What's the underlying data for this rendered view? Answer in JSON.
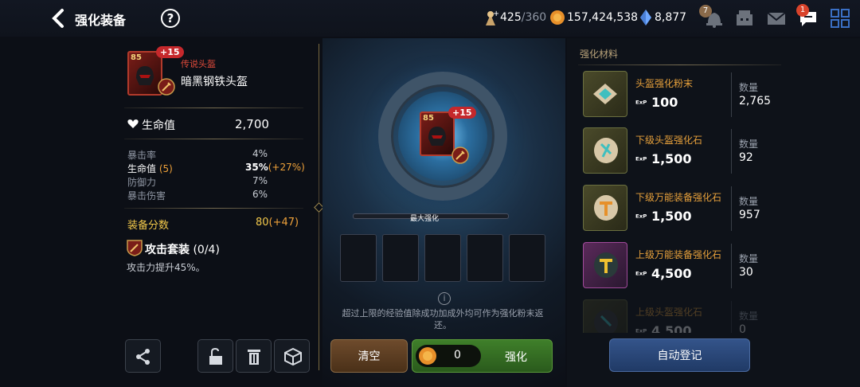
{
  "header": {
    "title": "强化装备",
    "help": "?",
    "stamina": "425",
    "stamina_max": "/360",
    "gold": "157,424,538",
    "crystal": "8,877",
    "bell_badge": "7",
    "chat_badge": "1"
  },
  "item": {
    "level": "85",
    "enhance": "+15",
    "grade": "传说头盔",
    "name": "暗黑钢铁头盔"
  },
  "main_stat": {
    "label": "生命值",
    "value": "2,700"
  },
  "stats": [
    {
      "label": "暴击率",
      "value": "4%",
      "bonus": ""
    },
    {
      "label": "生命值",
      "label_extra": "(5)",
      "value": "35%",
      "bonus": "(+27%)"
    },
    {
      "label": "防御力",
      "value": "7%",
      "bonus": ""
    },
    {
      "label": "暴击伤害",
      "value": "6%",
      "bonus": ""
    }
  ],
  "score": {
    "label": "装备分数",
    "value": "80",
    "bonus": "(+47)"
  },
  "set": {
    "name": "攻击套装",
    "count": "(0/4)",
    "desc": "攻击力提升45%。"
  },
  "center": {
    "max_label": "最大强化",
    "notice": "超过上限的经验值除成功加成外均可作为强化粉末返还。",
    "clear_label": "清空",
    "cost": "0",
    "enhance_label": "强化"
  },
  "materials": {
    "title": "强化材料",
    "qty_label": "数量",
    "items": [
      {
        "name": "头盔强化粉末",
        "exp": "100",
        "qty": "2,765"
      },
      {
        "name": "下级头盔强化石",
        "exp": "1,500",
        "qty": "92"
      },
      {
        "name": "下级万能装备强化石",
        "exp": "1,500",
        "qty": "957"
      },
      {
        "name": "上级万能装备强化石",
        "exp": "4,500",
        "qty": "30"
      },
      {
        "name": "上级头盔强化石",
        "exp": "4,500",
        "qty": "0"
      }
    ],
    "auto_label": "自动登记"
  },
  "colors": {
    "accent_gold": "#f3c94b",
    "bonus_orange": "#f0a23a",
    "enhance_green": "#3f7f2a",
    "clear_brown": "#6b4a2a",
    "auto_blue": "#2d4a78"
  }
}
